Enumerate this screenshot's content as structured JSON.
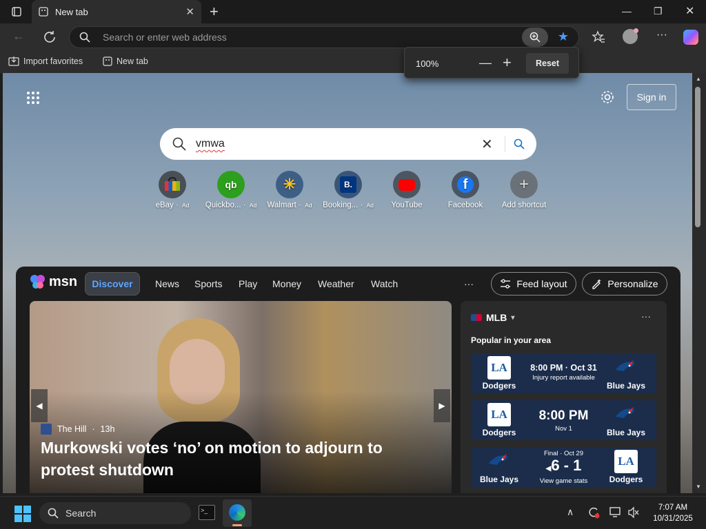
{
  "browser": {
    "tab_title": "New tab",
    "address_placeholder": "Search or enter web address",
    "bookmarks": [
      "Import favorites",
      "New tab"
    ],
    "zoom": {
      "level": "100%",
      "reset_label": "Reset"
    }
  },
  "newtab": {
    "sign_in": "Sign in",
    "search_query": "vmwa",
    "shortcuts": [
      {
        "label": "eBay",
        "ad": "Ad",
        "color": "#3a3f44"
      },
      {
        "label": "Quickbo...",
        "ad": "Ad",
        "color": "#2ca01c"
      },
      {
        "label": "Walmart",
        "ad": "Ad",
        "color": "#0071ce"
      },
      {
        "label": "Booking...",
        "ad": "Ad",
        "color": "#003580"
      },
      {
        "label": "YouTube",
        "ad": "",
        "color": "#ff0000"
      },
      {
        "label": "Facebook",
        "ad": "",
        "color": "#1877f2"
      },
      {
        "label": "Add shortcut",
        "ad": "",
        "color": "#555"
      }
    ]
  },
  "msn": {
    "brand": "msn",
    "tabs": [
      "Discover",
      "News",
      "Sports",
      "Play",
      "Money",
      "Weather",
      "Watch"
    ],
    "more": "···",
    "feed_layout": "Feed layout",
    "personalize": "Personalize",
    "hero": {
      "source": "The Hill",
      "age": "13h",
      "headline": "Murkowski votes ‘no’ on motion to adjourn to protest shutdown"
    },
    "sports": {
      "league": "MLB",
      "subtitle": "Popular in your area",
      "games": [
        {
          "left": "Dodgers",
          "right": "Blue Jays",
          "main": "8:00 PM · Oct 31",
          "sub": "Injury report available"
        },
        {
          "left": "Dodgers",
          "right": "Blue Jays",
          "main": "8:00 PM",
          "sub": "Nov 1"
        },
        {
          "left": "Blue Jays",
          "right": "Dodgers",
          "top": "Final · Oct 29",
          "main": "6 - 1",
          "sub": "View game stats"
        }
      ]
    }
  },
  "taskbar": {
    "search": "Search",
    "time": "7:07 AM",
    "date": "10/31/2025"
  }
}
